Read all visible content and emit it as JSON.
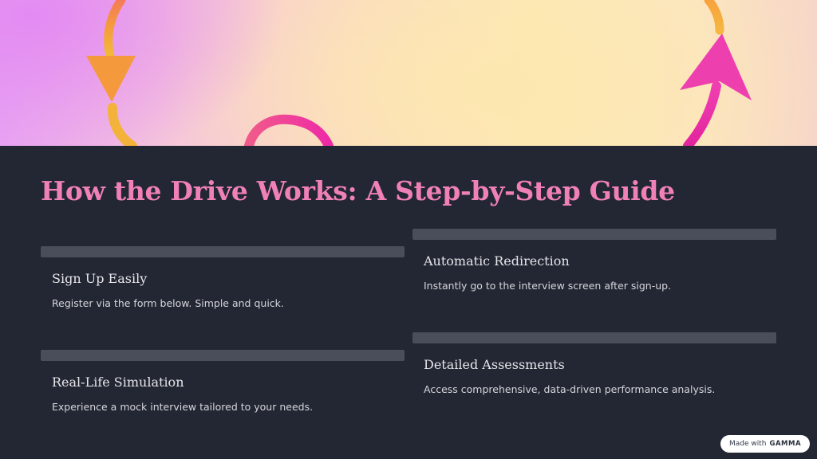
{
  "hero": {
    "image": "decorative-arrows-gradient",
    "arrow_colors": [
      "#f59a3c",
      "#f0b43a",
      "#ee3fae",
      "#e62aa0"
    ]
  },
  "page": {
    "title": "How the Drive Works: A Step-by-Step Guide",
    "title_color": "#f080b8",
    "background": "#232733"
  },
  "steps": [
    {
      "title": "Sign Up Easily",
      "description": "Register via the form below. Simple and quick."
    },
    {
      "title": "Automatic Redirection",
      "description": "Instantly go to the interview screen after sign-up."
    },
    {
      "title": "Real-Life Simulation",
      "description": "Experience a mock interview tailored to your needs."
    },
    {
      "title": "Detailed Assessments",
      "description": "Access comprehensive, data-driven performance analysis."
    }
  ],
  "badge": {
    "prefix": "Made with",
    "brand": "GAMMA"
  }
}
